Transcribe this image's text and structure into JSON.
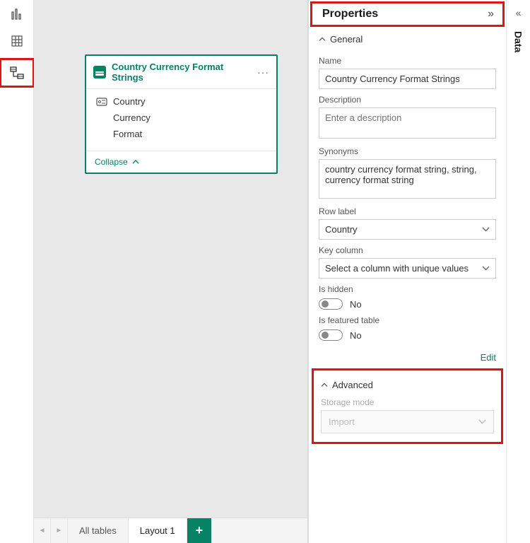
{
  "rail": {
    "report_tooltip": "Report view",
    "data_tooltip": "Data view",
    "model_tooltip": "Model view"
  },
  "table_card": {
    "title": "Country Currency Format Strings",
    "fields": [
      "Country",
      "Currency",
      "Format"
    ],
    "collapse_label": "Collapse"
  },
  "tabs": {
    "all_tables": "All tables",
    "layout1": "Layout 1"
  },
  "properties": {
    "title": "Properties",
    "general_label": "General",
    "name_label": "Name",
    "name_value": "Country Currency Format Strings",
    "description_label": "Description",
    "description_placeholder": "Enter a description",
    "synonyms_label": "Synonyms",
    "synonyms_value": "country currency format string, string, currency format string",
    "row_label_label": "Row label",
    "row_label_value": "Country",
    "key_column_label": "Key column",
    "key_column_placeholder": "Select a column with unique values",
    "is_hidden_label": "Is hidden",
    "is_hidden_value": "No",
    "is_featured_label": "Is featured table",
    "is_featured_value": "No",
    "edit_label": "Edit",
    "advanced_label": "Advanced",
    "storage_mode_label": "Storage mode",
    "storage_mode_value": "Import"
  },
  "data_pane": {
    "label": "Data"
  }
}
